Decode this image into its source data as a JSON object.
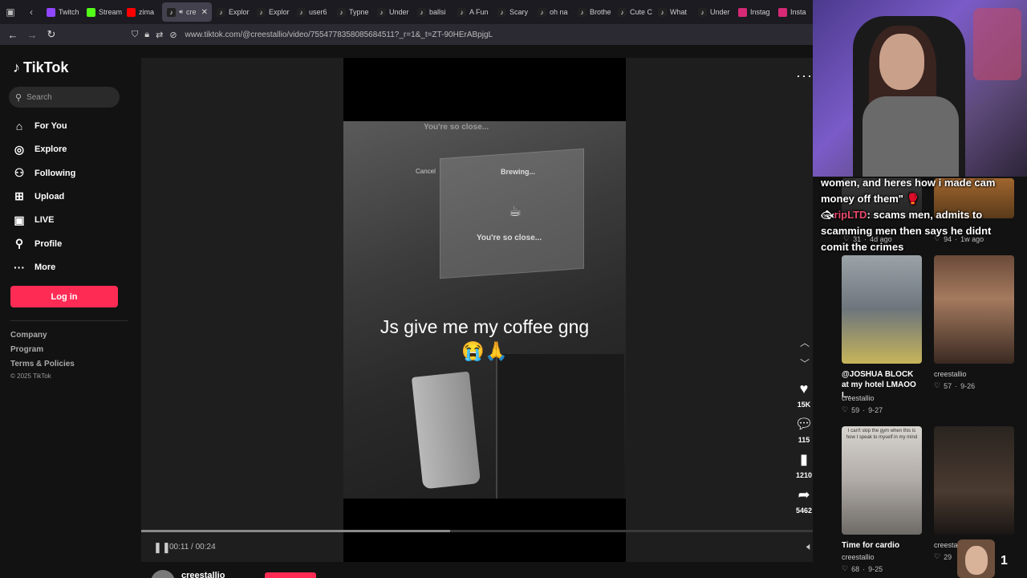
{
  "browser": {
    "tabs": [
      {
        "label": "Twitch",
        "fav": "twitch",
        "color": "#9146ff"
      },
      {
        "label": "Stream",
        "fav": "kick",
        "color": "#53fc18"
      },
      {
        "label": "zima",
        "fav": "youtube",
        "color": "#ff0000"
      },
      {
        "label": "cre",
        "fav": "tiktok",
        "color": "#222222",
        "active": true
      },
      {
        "label": "Explor",
        "fav": "tiktok",
        "color": "#222222"
      },
      {
        "label": "Explor",
        "fav": "tiktok",
        "color": "#222222"
      },
      {
        "label": "user6",
        "fav": "tiktok",
        "color": "#222222"
      },
      {
        "label": "Typne",
        "fav": "tiktok",
        "color": "#222222"
      },
      {
        "label": "Under",
        "fav": "tiktok",
        "color": "#222222"
      },
      {
        "label": "ballsi",
        "fav": "tiktok",
        "color": "#222222"
      },
      {
        "label": "A Fun",
        "fav": "tiktok",
        "color": "#222222"
      },
      {
        "label": "Scary",
        "fav": "tiktok",
        "color": "#222222"
      },
      {
        "label": "oh na",
        "fav": "tiktok",
        "color": "#222222"
      },
      {
        "label": "Brothe",
        "fav": "tiktok",
        "color": "#222222"
      },
      {
        "label": "Cute C",
        "fav": "tiktok",
        "color": "#222222"
      },
      {
        "label": "What",
        "fav": "tiktok",
        "color": "#222222"
      },
      {
        "label": "Under",
        "fav": "tiktok",
        "color": "#222222"
      },
      {
        "label": "Instag",
        "fav": "instagram",
        "color": "#d62976"
      },
      {
        "label": "Insta",
        "fav": "instagram",
        "color": "#d62976"
      }
    ],
    "url": "www.tiktok.com/@creestallio/video/7554778358085684511?_r=1&_t=ZT-90HErABpjgL"
  },
  "sidebar": {
    "logo": "TikTok",
    "search_placeholder": "Search",
    "nav": [
      {
        "label": "For You",
        "icon": "home-icon",
        "glyph": "⌂"
      },
      {
        "label": "Explore",
        "icon": "compass-icon",
        "glyph": "◎"
      },
      {
        "label": "Following",
        "icon": "person-icon",
        "glyph": "⚇"
      },
      {
        "label": "Upload",
        "icon": "plus-square-icon",
        "glyph": "⊞"
      },
      {
        "label": "LIVE",
        "icon": "tv-icon",
        "glyph": "▣"
      },
      {
        "label": "Profile",
        "icon": "user-icon",
        "glyph": "⚲"
      },
      {
        "label": "More",
        "icon": "dots-icon",
        "glyph": "···"
      }
    ],
    "login": "Log in",
    "footer": [
      "Company",
      "Program",
      "Terms & Policies"
    ],
    "copyright": "© 2025 TikTok"
  },
  "video": {
    "caption_line1": "Js give me my coffee gng",
    "caption_line2": "😭🙏",
    "screen_top": "You're so close...",
    "screen_cancel": "Cancel",
    "screen_brewing": "Brewing...",
    "screen_close": "You're so close...",
    "time": "00:11 / 00:24",
    "progress": 0.46,
    "likes": "15K",
    "comments": "115",
    "saves": "1210",
    "shares": "5462",
    "author": "creestallio"
  },
  "stream": {
    "chat_line1": "women, and heres how i made cam money off them\" 🥊",
    "chat_user": "ripLTD",
    "chat_line2": ": scams men, admits to scamming men then says he didnt comit the crimes",
    "badge_count": "1"
  },
  "related": {
    "top_row": [
      {
        "likes": "31",
        "age": "4d ago"
      },
      {
        "likes": "94",
        "age": "1w ago"
      }
    ],
    "videos": [
      {
        "title": "@JOSHUA BLOCK at my hotel LMAOO I...",
        "author": "creestallio",
        "likes": "59",
        "date": "9-27",
        "thumb_text": ""
      },
      {
        "title": "",
        "author": "creestallio",
        "likes": "57",
        "date": "9-26",
        "thumb_text": ""
      },
      {
        "title": "Time for cardio",
        "author": "creestallio",
        "likes": "68",
        "date": "9-25",
        "thumb_text": "I can't skip the gym when this is how I speak to myself in my mind"
      },
      {
        "title": "",
        "author": "creesta",
        "likes": "29",
        "date": "",
        "thumb_text": ""
      }
    ]
  }
}
